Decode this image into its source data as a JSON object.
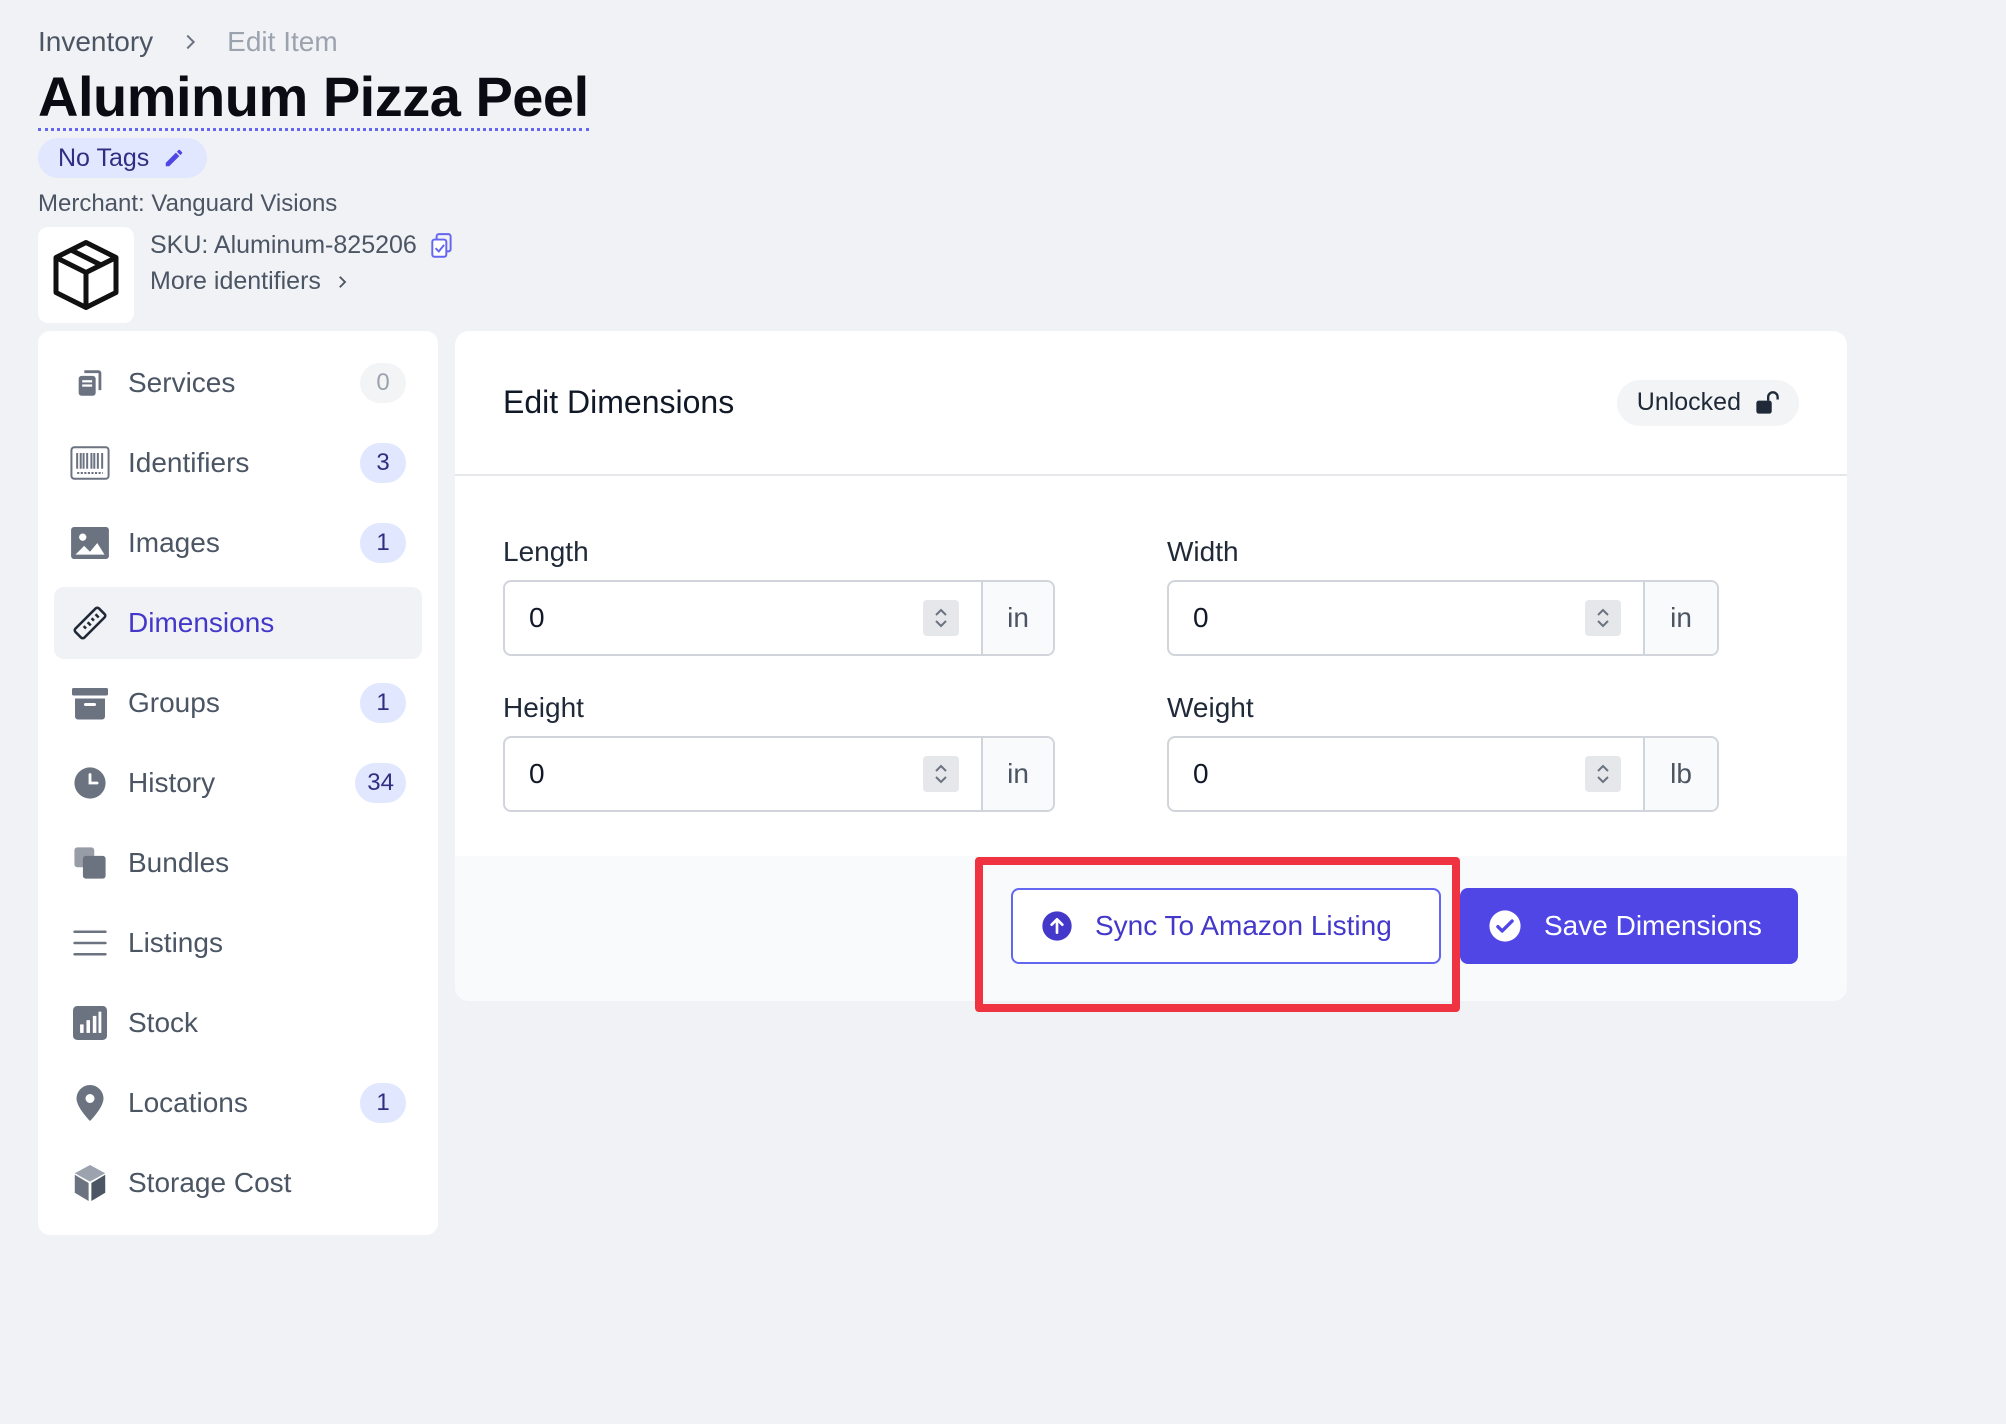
{
  "breadcrumb": {
    "parent": "Inventory",
    "current": "Edit Item"
  },
  "item": {
    "title": "Aluminum Pizza Peel",
    "tags_label": "No Tags",
    "merchant": "Merchant: Vanguard Visions",
    "sku": "SKU: Aluminum-825206",
    "more_identifiers": "More identifiers"
  },
  "sidebar": {
    "items": [
      {
        "label": "Services",
        "count": "0",
        "icon": "services-icon"
      },
      {
        "label": "Identifiers",
        "count": "3",
        "icon": "barcode-icon"
      },
      {
        "label": "Images",
        "count": "1",
        "icon": "image-icon"
      },
      {
        "label": "Dimensions",
        "count": "",
        "icon": "ruler-icon",
        "active": true
      },
      {
        "label": "Groups",
        "count": "1",
        "icon": "archive-icon"
      },
      {
        "label": "History",
        "count": "34",
        "icon": "clock-icon"
      },
      {
        "label": "Bundles",
        "count": "",
        "icon": "stack-icon"
      },
      {
        "label": "Listings",
        "count": "",
        "icon": "list-icon"
      },
      {
        "label": "Stock",
        "count": "",
        "icon": "chart-icon"
      },
      {
        "label": "Locations",
        "count": "1",
        "icon": "pin-icon"
      },
      {
        "label": "Storage Cost",
        "count": "",
        "icon": "cube-icon"
      }
    ]
  },
  "panel": {
    "title": "Edit Dimensions",
    "lock_label": "Unlocked",
    "fields": {
      "length": {
        "label": "Length",
        "value": "0",
        "unit": "in"
      },
      "width": {
        "label": "Width",
        "value": "0",
        "unit": "in"
      },
      "height": {
        "label": "Height",
        "value": "0",
        "unit": "in"
      },
      "weight": {
        "label": "Weight",
        "value": "0",
        "unit": "lb"
      }
    },
    "sync_label": "Sync To Amazon Listing",
    "save_label": "Save Dimensions"
  },
  "colors": {
    "accent": "#4f46e5",
    "highlight": "#ef3340",
    "badge_bg": "#e0e7ff"
  }
}
